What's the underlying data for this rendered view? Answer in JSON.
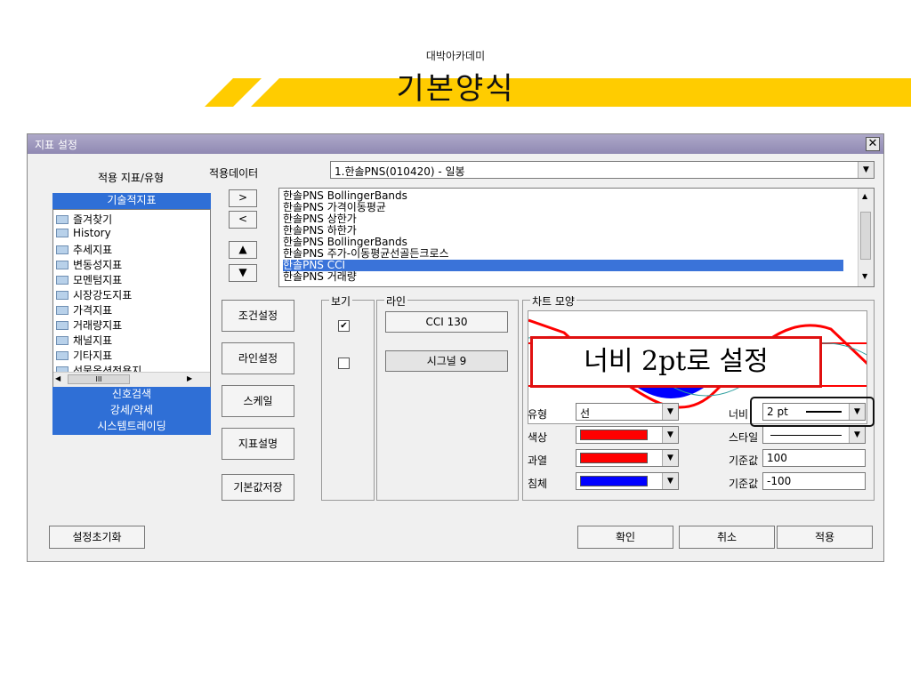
{
  "slide": {
    "subtitle": "대박아카데미",
    "title": "기본양식"
  },
  "dialog": {
    "title": "지표 설정",
    "indicator_heading": "적용 지표/유형",
    "tech_tab": "기술적지표",
    "tree_items": [
      "즐겨찾기",
      "History",
      "추세지표",
      "변동성지표",
      "모멘텀지표",
      "시장강도지표",
      "가격지표",
      "거래량지표",
      "채널지표",
      "기타지표",
      "선물옵션전용지"
    ],
    "hscroll_label": "III",
    "category_tabs": [
      "신호검색",
      "강세/약세",
      "시스템트레이딩"
    ],
    "data_label": "적용데이터",
    "data_value": "1.한솔PNS(010420) - 일봉",
    "move_buttons": [
      ">",
      "<",
      "▲",
      "▼"
    ],
    "applied_items": [
      "한솔PNS BollingerBands",
      "한솔PNS 가격이동평균",
      "한솔PNS 상한가",
      "한솔PNS 하한가",
      "한솔PNS BollingerBands",
      "한솔PNS 주가-이동평균선골든크로스",
      "한솔PNS CCI",
      "한솔PNS 거래량"
    ],
    "selected_applied_index": 6,
    "action_buttons": [
      "조건설정",
      "라인설정",
      "스케일",
      "지표설명",
      "기본값저장"
    ],
    "view_legend": "보기",
    "view_checks": [
      true,
      false
    ],
    "line_legend": "라인",
    "line_buttons": [
      "CCI 130",
      "시그널 9"
    ],
    "chart_legend": "차트 모양",
    "props": {
      "type_label": "유형",
      "type_value": "선",
      "color_label": "색상",
      "color_value": "#ff0000",
      "overheat_label": "과열",
      "overheat_value": "#ff0000",
      "sink_label": "침체",
      "sink_value": "#0000ff",
      "width_label": "너비",
      "width_value": "2 pt",
      "style_label": "스타일",
      "base1_label": "기준값",
      "base1_value": "100",
      "base2_label": "기준값",
      "base2_value": "-100"
    },
    "reset_button": "설정초기화",
    "ok_button": "확인",
    "cancel_button": "취소",
    "apply_button": "적용"
  },
  "annotation": {
    "callout_text": "너비 2pt로 설정"
  },
  "colors": {
    "banner": "#ffcc00",
    "accent_blue": "#2f6fd6",
    "callout_border": "#e01010"
  }
}
